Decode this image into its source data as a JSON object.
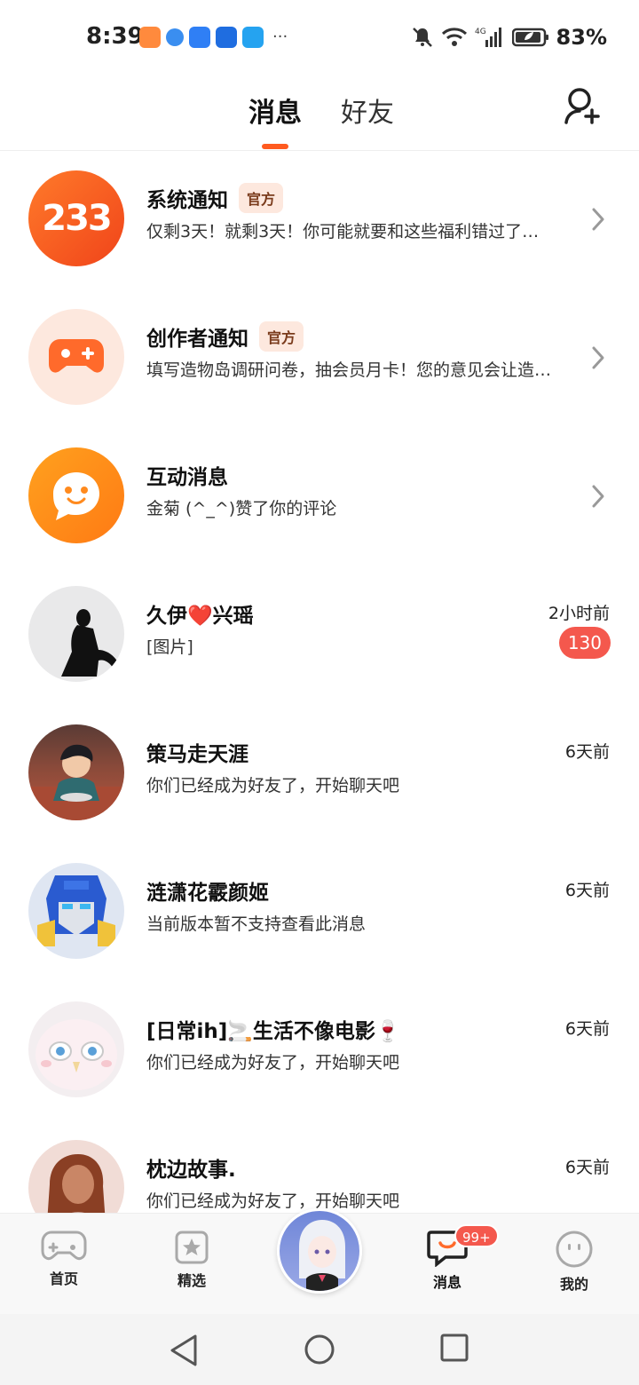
{
  "status_bar": {
    "time": "8:39",
    "battery": "83%",
    "network": "4G",
    "more": "···"
  },
  "header": {
    "tabs": [
      {
        "label": "消息",
        "active": true
      },
      {
        "label": "好友",
        "active": false
      }
    ],
    "add_friend_icon": "add-user-icon"
  },
  "accent_color": "#ff5a1f",
  "messages": [
    {
      "title": "系统通知",
      "badge": "官方",
      "subtitle": "仅剩3天！就剩3天！你可能就要和这些福利错过了…",
      "avatar_text": "233",
      "chevron": true
    },
    {
      "title": "创作者通知",
      "badge": "官方",
      "subtitle": "填写造物岛调研问卷，抽会员月卡！您的意见会让造…",
      "avatar_icon": "gamepad-icon",
      "chevron": true
    },
    {
      "title": "互动消息",
      "subtitle": "金菊 (^_^)赞了你的评论",
      "avatar_icon": "chat-bubble-face-icon",
      "chevron": true
    },
    {
      "title": "久伊❤️兴瑶",
      "subtitle": "[图片]",
      "time": "2小时前",
      "unread": "130"
    },
    {
      "title": "策马走天涯",
      "subtitle": "你们已经成为好友了，开始聊天吧",
      "time": "6天前"
    },
    {
      "title": "涟潇花霰颜姬",
      "subtitle": "当前版本暂不支持查看此消息",
      "time": "6天前"
    },
    {
      "title": "[日常ih]🚬生活不像电影🍷",
      "subtitle": "你们已经成为好友了，开始聊天吧",
      "time": "6天前"
    },
    {
      "title": "枕边故事.",
      "subtitle": "你们已经成为好友了，开始聊天吧",
      "time": "6天前"
    }
  ],
  "bottom_nav": {
    "items": [
      {
        "label": "首页",
        "icon": "gamepad-icon"
      },
      {
        "label": "精选",
        "icon": "star-icon"
      },
      {
        "label": "消息",
        "icon": "message-icon",
        "badge": "99+"
      },
      {
        "label": "我的",
        "icon": "face-icon"
      }
    ]
  }
}
